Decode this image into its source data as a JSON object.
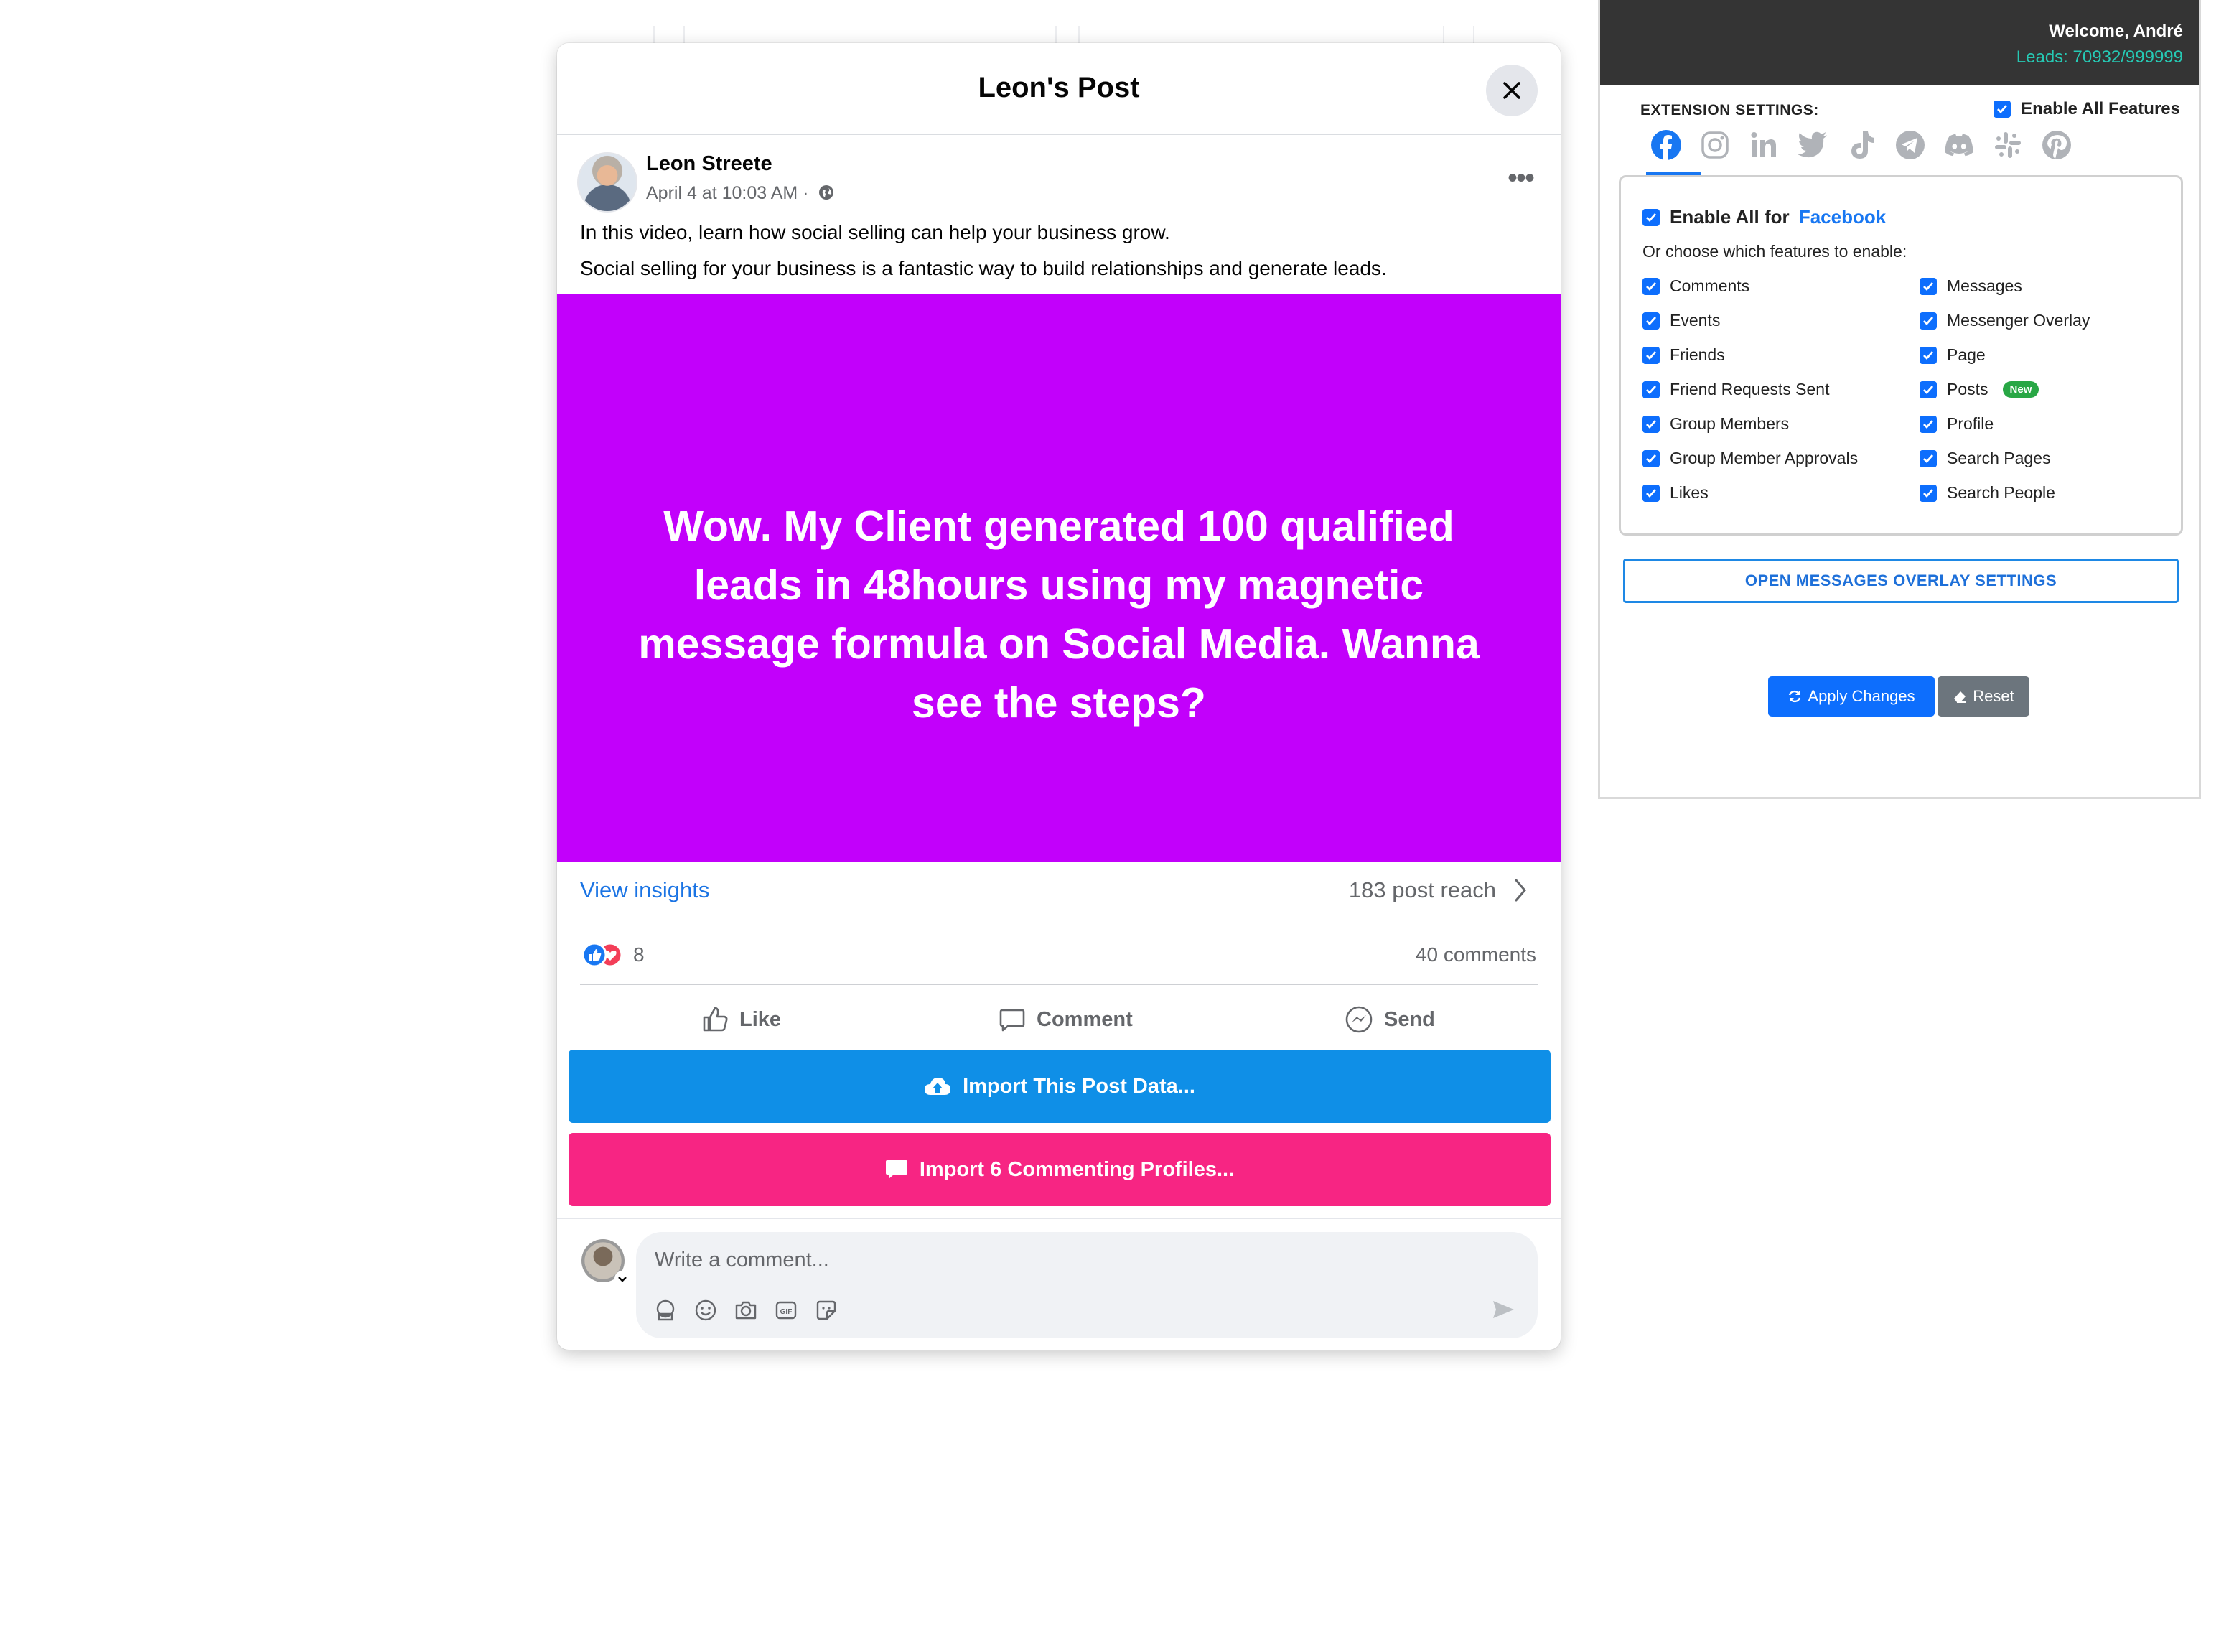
{
  "post_modal": {
    "title": "Leon's Post",
    "author": "Leon Streete",
    "date": "April 4 at 10:03 AM ·",
    "text_line1": "In this video, learn how social selling can help your business grow.",
    "text_line2": "Social selling for your business is a fantastic way to build relationships and generate leads.",
    "banner_text": "Wow. My Client generated 100 qualified leads in 48hours using my magnetic message formula on Social Media. Wanna see the steps?",
    "banner_color": "#c200fb",
    "insights_label": "View insights",
    "reach": "183 post reach",
    "reaction_count": "8",
    "comments_count": "40 comments",
    "actions": {
      "like": "Like",
      "comment": "Comment",
      "send": "Send"
    },
    "import_post_label": "Import This Post Data...",
    "import_profiles_label": "Import 6 Commenting Profiles...",
    "comment_placeholder": "Write a comment..."
  },
  "extension": {
    "welcome": "Welcome, André",
    "leads": "Leads: 70932/999999",
    "settings_label": "EXTENSION SETTINGS:",
    "enable_all": "Enable All Features",
    "platforms": [
      "facebook-icon",
      "instagram-icon",
      "linkedin-icon",
      "twitter-icon",
      "tiktok-icon",
      "telegram-icon",
      "discord-icon",
      "slack-icon",
      "pinterest-icon"
    ],
    "enable_platform_prefix": "Enable All for",
    "platform_name": "Facebook",
    "choose_label": "Or choose which features to enable:",
    "features_left": [
      "Comments",
      "Events",
      "Friends",
      "Friend Requests Sent",
      "Group Members",
      "Group Member Approvals",
      "Likes"
    ],
    "features_right": [
      "Messages",
      "Messenger Overlay",
      "Page",
      "Posts",
      "Profile",
      "Search Pages",
      "Search People"
    ],
    "new_badge": "New",
    "open_overlay": "OPEN MESSAGES OVERLAY SETTINGS",
    "apply": "Apply Changes",
    "reset": "Reset"
  }
}
